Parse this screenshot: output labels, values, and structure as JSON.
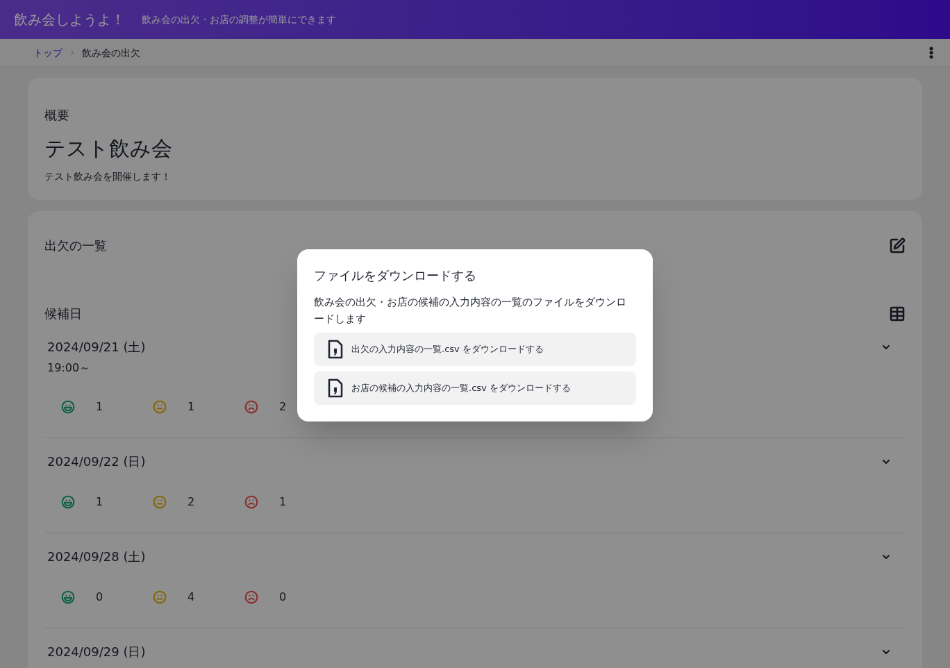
{
  "header": {
    "title": "飲み会しようよ！",
    "subtitle": "飲み会の出欠・お店の調整が簡単にできます"
  },
  "breadcrumb": [
    {
      "label": "トップ",
      "kind": "link"
    },
    {
      "label": "飲み会の出欠",
      "kind": "current"
    }
  ],
  "overview": {
    "heading": "概要",
    "title": "テスト飲み会",
    "description": "テスト飲み会を開催します！"
  },
  "attendance": {
    "heading": "出欠の一覧",
    "dates_heading": "候補日",
    "dates": [
      {
        "date": "2024/09/21 (土)",
        "time": "19:00～",
        "counts": [
          "1",
          "1",
          "2"
        ]
      },
      {
        "date": "2024/09/22 (日)",
        "counts": [
          "1",
          "2",
          "1"
        ]
      },
      {
        "date": "2024/09/28 (土)",
        "counts": [
          "0",
          "4",
          "0"
        ]
      },
      {
        "date": "2024/09/29 (日)"
      }
    ]
  },
  "dialog": {
    "title": "ファイルをダウンロードする",
    "message": "飲み会の出欠・お店の候補の入力内容の一覧のファイルをダウンロードします",
    "buttons": [
      "出欠の入力内容の一覧.csv をダウンロードする",
      "お店の候補の入力内容の一覧.csv をダウンロードする"
    ]
  }
}
